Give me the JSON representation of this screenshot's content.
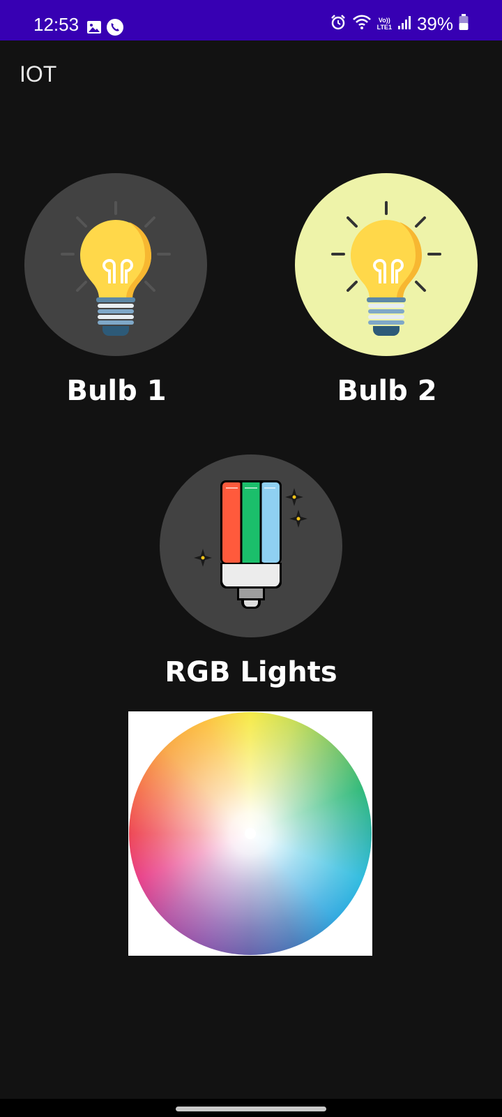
{
  "status_bar": {
    "time": "12:53",
    "battery_percent": "39%",
    "network": "LTE1",
    "volte": "Vo))"
  },
  "app": {
    "title": "IOT"
  },
  "devices": {
    "bulb1": {
      "label": "Bulb 1",
      "state": "off",
      "icon": "lightbulb-icon"
    },
    "bulb2": {
      "label": "Bulb 2",
      "state": "on",
      "icon": "lightbulb-icon"
    },
    "rgb": {
      "label": "RGB Lights",
      "icon": "rgb-light-icon"
    }
  },
  "color_picker": {
    "icon": "color-wheel"
  },
  "colors": {
    "status_bar": "#3700b3",
    "background": "#121212",
    "circle_off": "#424242",
    "circle_on": "#eef3a9",
    "bulb_yellow": "#ffd84a",
    "bulb_base": "#7fa8c8"
  }
}
